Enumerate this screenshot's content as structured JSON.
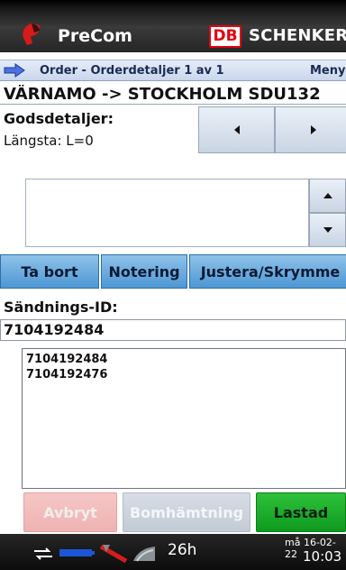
{
  "app": {
    "title": "PreCom"
  },
  "brand": {
    "db": "DB",
    "name": "SCHENKER",
    "color": "#e4000f"
  },
  "nav": {
    "title": "Order - Orderdetaljer 1 av 1",
    "menu": "Meny"
  },
  "route": "VÄRNAMO -> STOCKHOLM SDU132",
  "goods": {
    "title": "Godsdetaljer:",
    "length": "Längsta: L=0"
  },
  "actions": {
    "remove": "Ta bort",
    "note": "Notering",
    "adjust": "Justera/Skrymme"
  },
  "shipment": {
    "label": "Sändnings-ID:",
    "value": "7104192484",
    "list": [
      "7104192484",
      "7104192476"
    ]
  },
  "bottom": {
    "cancel": "Avbryt",
    "pickup": "Bomhämtning",
    "loaded": "Lastad"
  },
  "status": {
    "hours": "26h",
    "date": "må 16-02-22",
    "time": "10:03"
  },
  "icons": [
    "logo-icon",
    "forward-arrow-icon",
    "sync-icon",
    "battery-icon",
    "signal-icon",
    "antenna-icon"
  ],
  "colors": {
    "accent_blue": "#4e97d4",
    "green": "#0e9a1f"
  }
}
